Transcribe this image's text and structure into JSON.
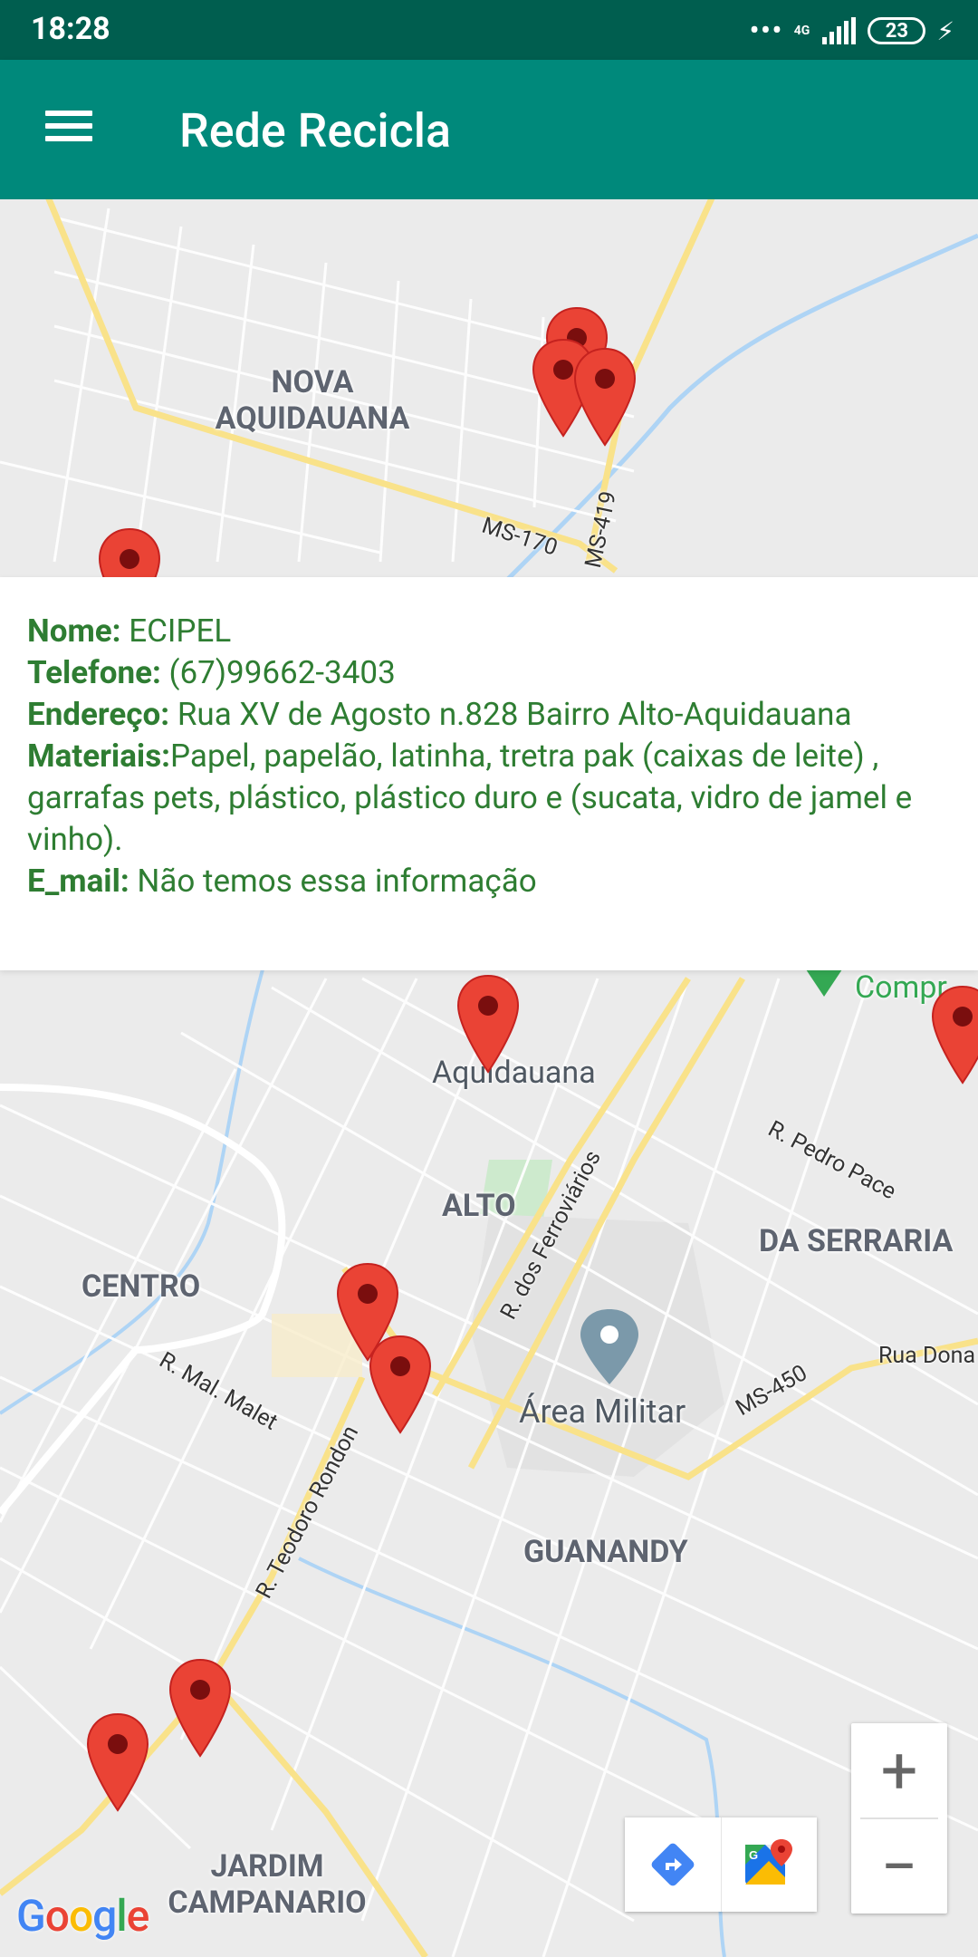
{
  "status_bar": {
    "time": "18:28",
    "network": "4G",
    "battery": "23"
  },
  "app_bar": {
    "title": "Rede Recicla"
  },
  "info": {
    "nome_label": "Nome:",
    "nome_value": " ECIPEL",
    "telefone_label": "Telefone:",
    "telefone_value": " (67)99662-3403",
    "endereco_label": "Endereço:",
    "endereco_value": " Rua XV de Agosto n.828 Bairro Alto-Aquidauana",
    "materiais_label": "Materiais:",
    "materiais_value": "Papel, papelão, latinha, tretra pak (caixas de leite) , garrafas pets, plástico, plástico duro e (sucata, vidro de jamel e vinho).",
    "email_label": "E_mail:",
    "email_value": " Não temos essa informação"
  },
  "map": {
    "areas": [
      {
        "line1": "NOVA",
        "line2": "AQUIDAUANA"
      },
      {
        "line1": "ALTO"
      },
      {
        "line1": "CENTRO"
      },
      {
        "line1": "DA SERRARIA"
      },
      {
        "line1": "GUANANDY"
      },
      {
        "line1": "JARDIM",
        "line2": "CAMPANARIO"
      }
    ],
    "places": [
      "Aquidauana",
      "Área Militar",
      "Compr"
    ],
    "roads": [
      "MS-170",
      "MS-419",
      "R. Pedro Pace",
      "R. dos Ferroviários",
      "R. Mal. Malet",
      "MS-450",
      "Rua Dona",
      "R. Teodoro Rondon"
    ],
    "marker_color": "#ea4335",
    "marker_count": 11
  },
  "controls": {
    "zoom_in": "+",
    "zoom_out": "−"
  },
  "attribution": "Google"
}
